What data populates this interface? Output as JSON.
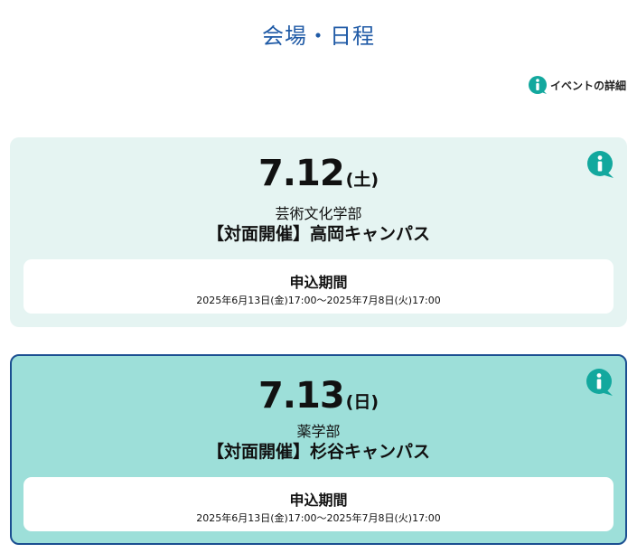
{
  "page": {
    "title": "会場・日程"
  },
  "event_detail": {
    "label": "イベントの詳細"
  },
  "colors": {
    "title": "#1f5aa6",
    "info_icon": "#13a89e",
    "card_light": "#e5f4f2",
    "card_selected": "#9ddfd9",
    "card_selected_border": "#1b4f91"
  },
  "icons": {
    "info": "info-icon"
  },
  "cards": [
    {
      "date": "7.12",
      "day": "(土)",
      "faculty": "芸術文化学部",
      "venue": "【対面開催】高岡キャンパス",
      "period_label": "申込期間",
      "period_range": "2025年6月13日(金)17:00〜2025年7月8日(火)17:00"
    },
    {
      "date": "7.13",
      "day": "(日)",
      "faculty": "薬学部",
      "venue": "【対面開催】杉谷キャンパス",
      "period_label": "申込期間",
      "period_range": "2025年6月13日(金)17:00〜2025年7月8日(火)17:00"
    }
  ]
}
